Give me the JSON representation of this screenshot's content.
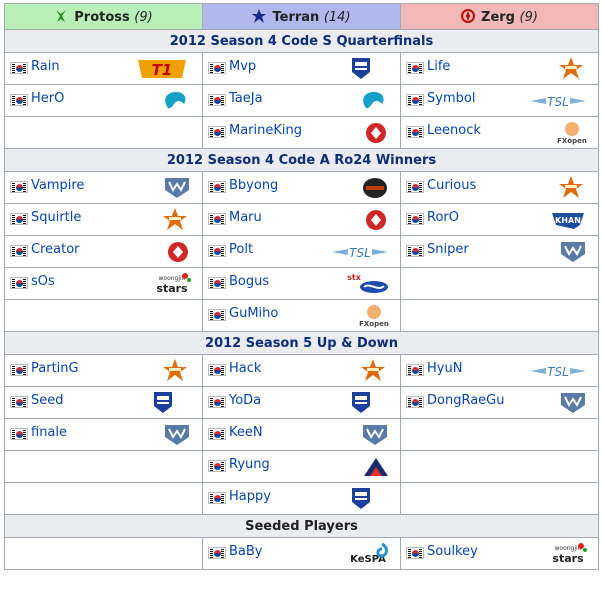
{
  "races": [
    {
      "name": "Protoss",
      "count": "(9)",
      "icon": "protoss-icon"
    },
    {
      "name": "Terran",
      "count": "(14)",
      "icon": "terran-icon"
    },
    {
      "name": "Zerg",
      "count": "(9)",
      "icon": "zerg-icon"
    }
  ],
  "sections": [
    {
      "title": "2012 Season 4 Code S Quarterfinals",
      "rows": [
        [
          {
            "player": "Rain",
            "team": "t1"
          },
          {
            "player": "Mvp",
            "team": "incredible-miracle"
          },
          {
            "player": "Life",
            "team": "startale"
          }
        ],
        [
          {
            "player": "HerO",
            "team": "liquid"
          },
          {
            "player": "TaeJa",
            "team": "liquid"
          },
          {
            "player": "Symbol",
            "team": "tsl"
          }
        ],
        [
          null,
          {
            "player": "MarineKing",
            "team": "prime"
          },
          {
            "player": "Leenock",
            "team": "fxopen"
          }
        ]
      ]
    },
    {
      "title": "2012 Season 4 Code A Ro24 Winners",
      "rows": [
        [
          {
            "player": "Vampire",
            "team": "mvp"
          },
          {
            "player": "Bbyong",
            "team": "ozone"
          },
          {
            "player": "Curious",
            "team": "startale"
          }
        ],
        [
          {
            "player": "Squirtle",
            "team": "startale"
          },
          {
            "player": "Maru",
            "team": "prime"
          },
          {
            "player": "RorO",
            "team": "khan"
          }
        ],
        [
          {
            "player": "Creator",
            "team": "prime"
          },
          {
            "player": "Polt",
            "team": "tsl"
          },
          {
            "player": "Sniper",
            "team": "mvp"
          }
        ],
        [
          {
            "player": "sOs",
            "team": "woongjin-stars"
          },
          {
            "player": "Bogus",
            "team": "stx-soul"
          },
          null
        ],
        [
          null,
          {
            "player": "GuMiho",
            "team": "fxopen"
          },
          null
        ]
      ]
    },
    {
      "title": "2012 Season 5 Up & Down",
      "rows": [
        [
          {
            "player": "PartinG",
            "team": "startale"
          },
          {
            "player": "Hack",
            "team": "startale"
          },
          {
            "player": "HyuN",
            "team": "tsl"
          }
        ],
        [
          {
            "player": "Seed",
            "team": "incredible-miracle"
          },
          {
            "player": "YoDa",
            "team": "incredible-miracle"
          },
          {
            "player": "DongRaeGu",
            "team": "mvp"
          }
        ],
        [
          {
            "player": "finale",
            "team": "mvp"
          },
          {
            "player": "KeeN",
            "team": "mvp"
          },
          null
        ],
        [
          null,
          {
            "player": "Ryung",
            "team": "azubu"
          },
          null
        ],
        [
          null,
          {
            "player": "Happy",
            "team": "incredible-miracle"
          },
          null
        ]
      ]
    },
    {
      "title": "Seeded Players",
      "seeded": true,
      "rows": [
        [
          null,
          {
            "player": "BaBy",
            "team": "kespa"
          },
          {
            "player": "Soulkey",
            "team": "woongjin-stars"
          }
        ]
      ]
    }
  ],
  "logo_text": {
    "t1": "T1",
    "tsl": "TSL",
    "fxopen": "FXopen",
    "stx": "stx",
    "woongjin_small": "woongjin",
    "stars": "stars",
    "kespa": "KeSPA",
    "khan": "KHAN"
  },
  "colors": {
    "protoss_header": "#b8f0b8",
    "terran_header": "#b0b8ee",
    "zerg_header": "#f2b8b8",
    "section_title": "#0b2e78",
    "player_link": "#0645ad",
    "border": "#a2a9b1"
  }
}
